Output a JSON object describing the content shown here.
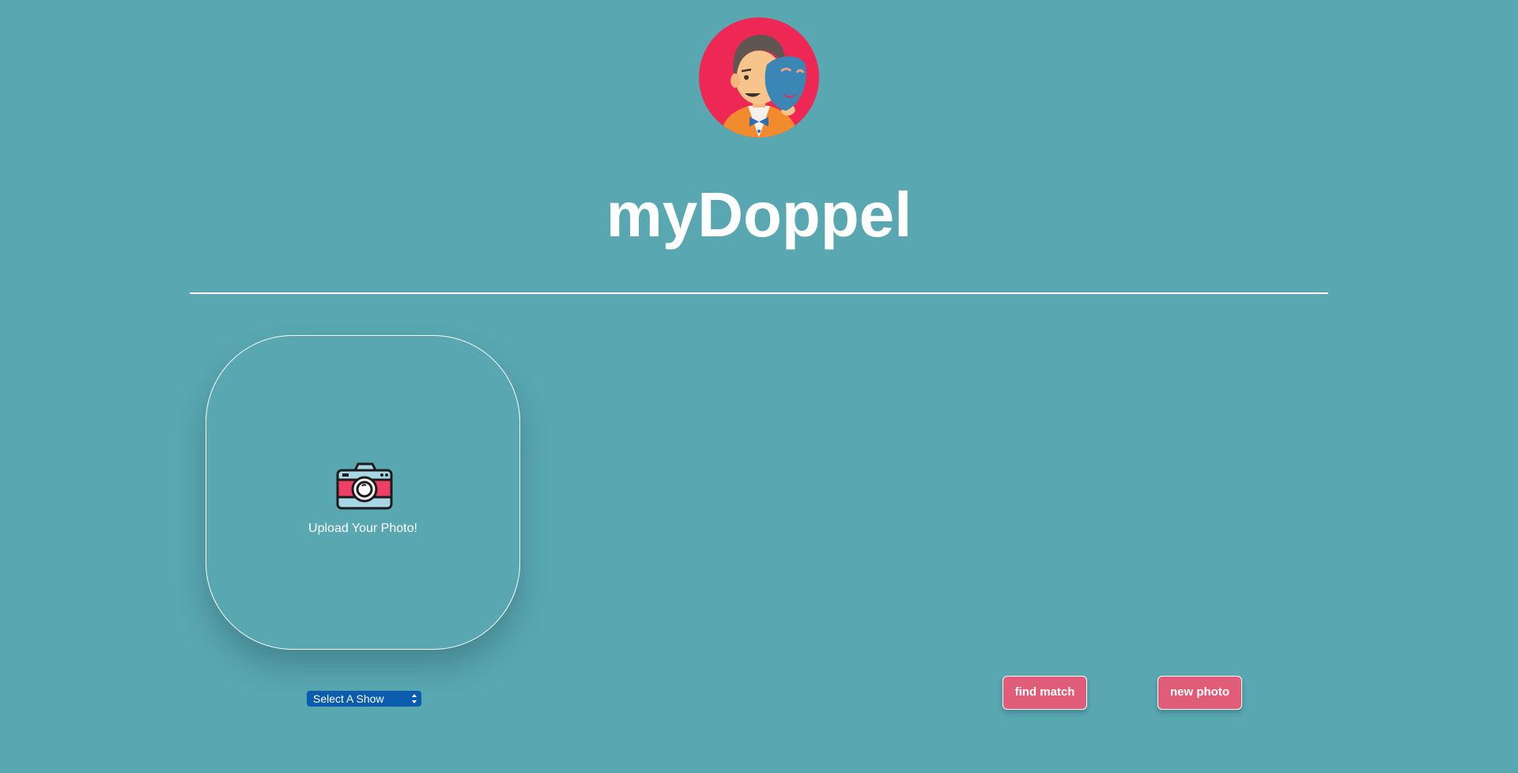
{
  "app": {
    "title": "myDoppel",
    "logo_icon": "doppelganger-mask-logo-icon"
  },
  "upload": {
    "icon": "camera-icon",
    "label": "Upload Your Photo!"
  },
  "show_select": {
    "selected": "Select A Show"
  },
  "actions": {
    "find_match_label": "find match",
    "new_photo_label": "new photo"
  },
  "colors": {
    "background": "#58a7b1",
    "logo_circle": "#ef2754",
    "button": "#e15c78",
    "select": "#0b5cad",
    "text": "#ffffff"
  }
}
